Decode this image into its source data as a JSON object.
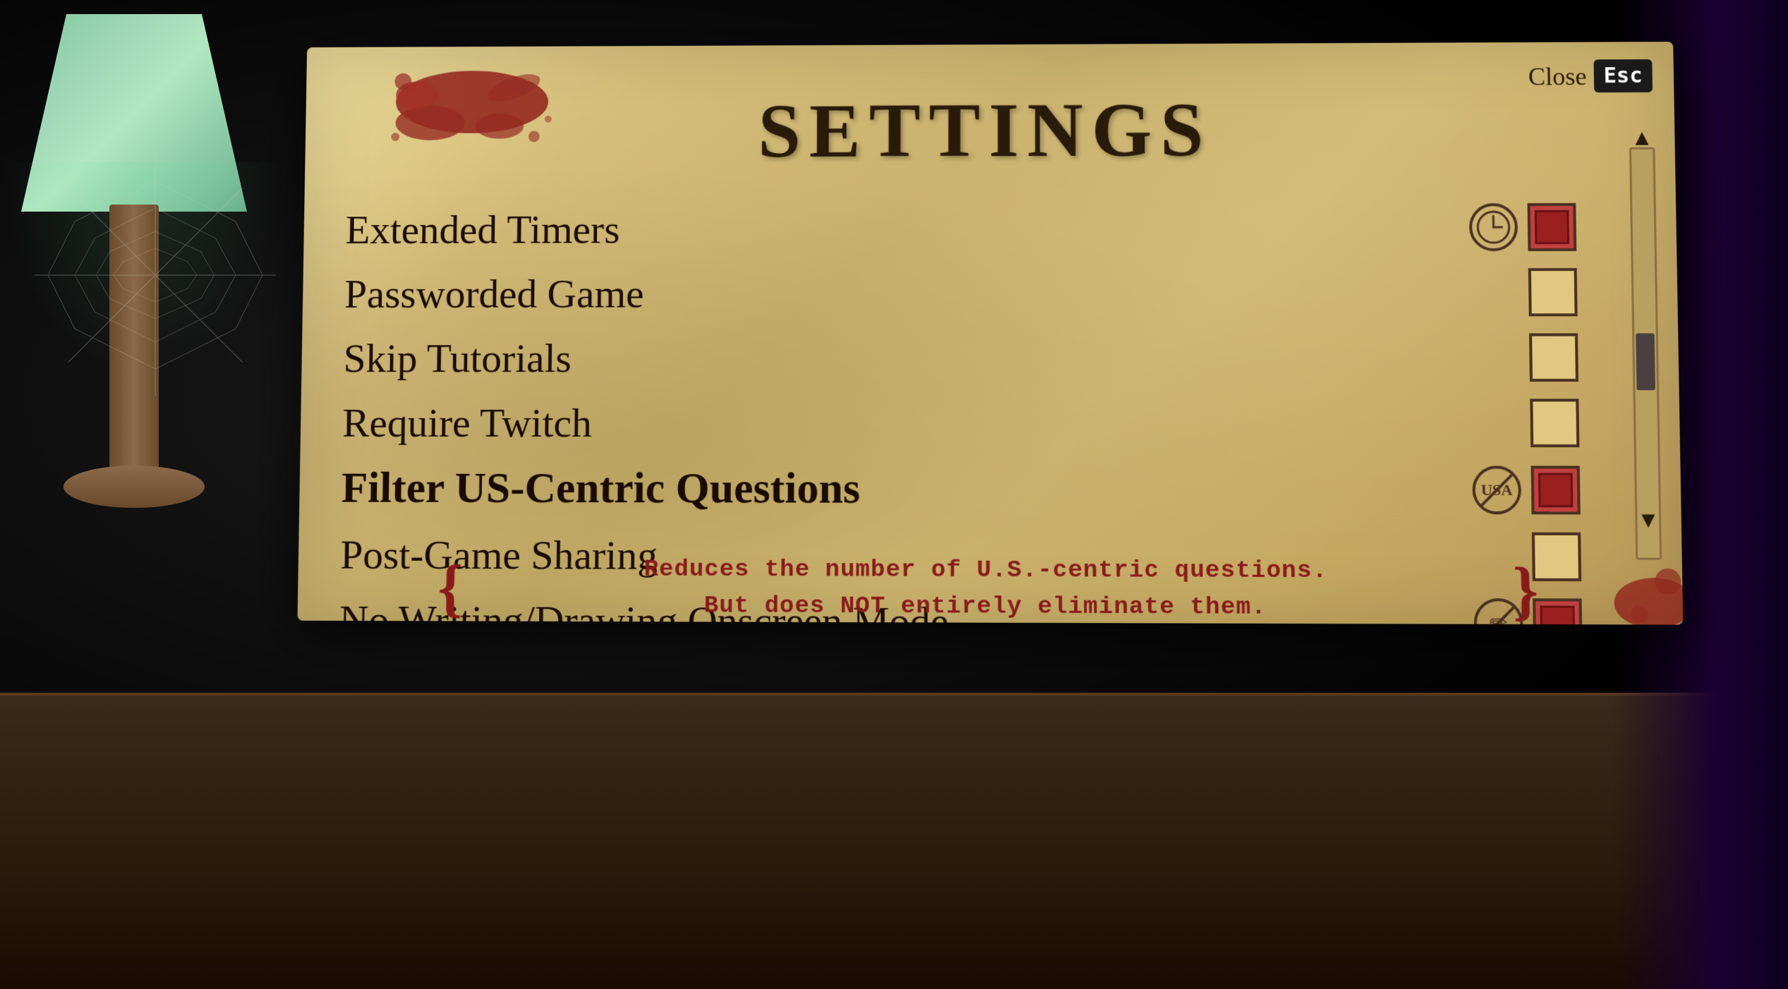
{
  "page": {
    "title": "SETTINGS",
    "close_label": "Close",
    "esc_label": "Esc"
  },
  "settings": {
    "items": [
      {
        "id": "extended-timers",
        "label": "Extended Timers",
        "checked": true,
        "bold": false,
        "has_clock_icon": true,
        "has_no_usa_icon": false,
        "has_no_pencil_icon": false
      },
      {
        "id": "passworded-game",
        "label": "Passworded Game",
        "checked": false,
        "bold": false,
        "has_clock_icon": false,
        "has_no_usa_icon": false,
        "has_no_pencil_icon": false
      },
      {
        "id": "skip-tutorials",
        "label": "Skip Tutorials",
        "checked": false,
        "bold": false,
        "has_clock_icon": false,
        "has_no_usa_icon": false,
        "has_no_pencil_icon": false
      },
      {
        "id": "require-twitch",
        "label": "Require Twitch",
        "checked": false,
        "bold": false,
        "has_clock_icon": false,
        "has_no_usa_icon": false,
        "has_no_pencil_icon": false
      },
      {
        "id": "filter-us-centric",
        "label": "Filter US-Centric Questions",
        "checked": true,
        "bold": true,
        "has_clock_icon": false,
        "has_no_usa_icon": true,
        "has_no_pencil_icon": false
      },
      {
        "id": "post-game-sharing",
        "label": "Post-Game Sharing",
        "checked": false,
        "bold": false,
        "has_clock_icon": false,
        "has_no_usa_icon": false,
        "has_no_pencil_icon": false
      },
      {
        "id": "no-writing-drawing",
        "label": "No Writing/Drawing Onscreen Mode",
        "checked": true,
        "bold": false,
        "has_clock_icon": false,
        "has_no_usa_icon": false,
        "has_no_pencil_icon": true
      }
    ],
    "active_description": {
      "line1": "Reduces the number of U.S.-centric questions.",
      "line2": "But does NOT entirely eliminate them."
    }
  },
  "scrollbar": {
    "up_arrow": "▲",
    "down_arrow": "▼"
  },
  "icons": {
    "clock": "clock-icon",
    "no_usa": "no-usa-icon",
    "no_pencil": "no-pencil-icon"
  }
}
